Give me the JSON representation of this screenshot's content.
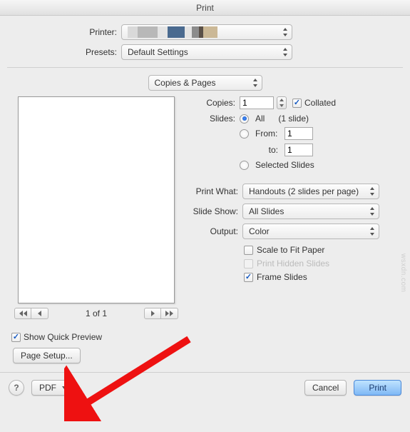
{
  "window": {
    "title": "Print"
  },
  "printer": {
    "label": "Printer:"
  },
  "presets": {
    "label": "Presets:",
    "value": "Default Settings"
  },
  "section_select": "Copies & Pages",
  "copies": {
    "label": "Copies:",
    "value": "1",
    "collated_label": "Collated"
  },
  "slides": {
    "label": "Slides:",
    "all_label": "All",
    "count_text": "(1 slide)",
    "from_label": "From:",
    "from_value": "1",
    "to_label": "to:",
    "to_value": "1",
    "selected_label": "Selected Slides"
  },
  "print_what": {
    "label": "Print What:",
    "value": "Handouts (2 slides per page)"
  },
  "slide_show": {
    "label": "Slide Show:",
    "value": "All Slides"
  },
  "output": {
    "label": "Output:",
    "value": "Color"
  },
  "options": {
    "scale": "Scale to Fit Paper",
    "hidden": "Print Hidden Slides",
    "frame": "Frame Slides"
  },
  "preview": {
    "pager": "1 of 1",
    "quick_preview": "Show Quick Preview",
    "page_setup": "Page Setup..."
  },
  "footer": {
    "pdf": "PDF",
    "cancel": "Cancel",
    "print": "Print"
  },
  "watermark": "wsxdn.com"
}
